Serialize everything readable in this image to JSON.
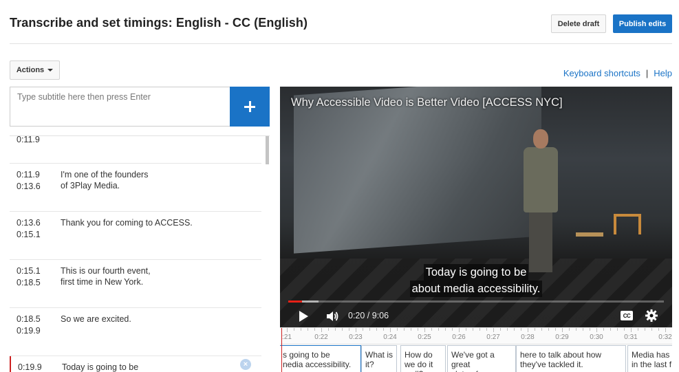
{
  "header": {
    "title": "Transcribe and set timings: English - CC (English)",
    "delete_label": "Delete draft",
    "publish_label": "Publish edits"
  },
  "toolbar": {
    "actions_label": "Actions",
    "keyboard_shortcuts": "Keyboard shortcuts",
    "separator": "|",
    "help": "Help"
  },
  "editor": {
    "placeholder": "Type subtitle here then press Enter",
    "add_icon": "plus-icon"
  },
  "subtitles": [
    {
      "start": "0:11.9",
      "end": "",
      "text": ""
    },
    {
      "start": "0:11.9",
      "end": "0:13.6",
      "text": "I'm one of the founders\nof 3Play Media."
    },
    {
      "start": "0:13.6",
      "end": "0:15.1",
      "text": "Thank you for coming to ACCESS."
    },
    {
      "start": "0:15.1",
      "end": "0:18.5",
      "text": "This is our fourth event,\nfirst time in New York."
    },
    {
      "start": "0:18.5",
      "end": "0:19.9",
      "text": "So we are excited."
    },
    {
      "start": "0:19.9",
      "end": "",
      "text": "Today is going to be"
    }
  ],
  "video": {
    "title": "Why Accessible Video is Better Video [ACCESS NYC]",
    "caption_line1": "Today is going to be",
    "caption_line2": "about media accessibility.",
    "time": "0:20 / 9:06",
    "progress": 0.037,
    "buffered": 0.08,
    "cc_label": "CC"
  },
  "timeline": {
    "ticks": [
      ":21",
      "0:22",
      "0:23",
      "0:24",
      "0:25",
      "0:26",
      "0:27",
      "0:28",
      "0:29",
      "0:30",
      "0:31",
      "0:32"
    ],
    "segments": [
      "s going to be\nnedia accessibility.",
      "What is\nit?",
      "How do\nwe do it\nwell?",
      "We've got a\ngreat\nslate of",
      "here to talk about how\nthey've tackled it.",
      "Media has\nin the last f"
    ]
  },
  "colors": {
    "accent": "#1a73c6",
    "progress": "#e62117",
    "active_marker": "#cc1f1f"
  }
}
